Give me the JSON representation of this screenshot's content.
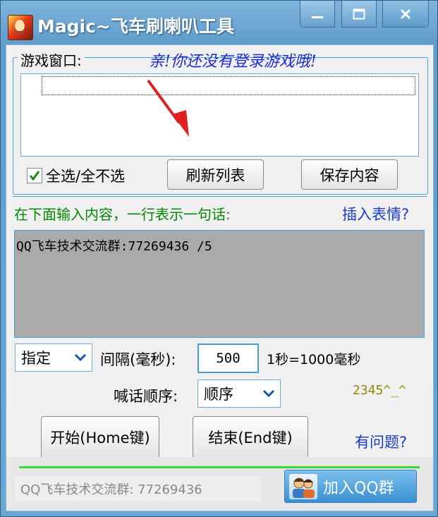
{
  "window": {
    "title": "Magic~飞车刷喇叭工具",
    "controls": {
      "minimize": "minimize-icon",
      "maximize": "maximize-icon",
      "close": "close-icon"
    }
  },
  "game_window_group": {
    "label": "游戏窗口:",
    "hint": "亲!你还没有登录游戏哦!",
    "select_all_checkbox": {
      "label": "全选/全不选",
      "checked": true
    },
    "refresh_button": "刷新列表",
    "save_button": "保存内容"
  },
  "message_input": {
    "instruction": "在下面输入内容，一行表示一句话:",
    "insert_emoji_link": "插入表情?",
    "content": "QQ飞车技术交流群:77269436 /5"
  },
  "settings": {
    "mode_select": "指定",
    "interval_label": "间隔(毫秒):",
    "interval_value": "500",
    "interval_note": "1秒=1000毫秒",
    "order_label": "喊话顺序:",
    "order_select": "顺序",
    "face_text": "2345^_^"
  },
  "actions": {
    "start_button": "开始(Home键)",
    "end_button": "结束(End键)",
    "help_link": "有问题?"
  },
  "footer": {
    "group_text": "QQ飞车技术交流群: 77269436",
    "join_qq_button": "加入QQ群"
  },
  "colors": {
    "titlebar": "#5f9ccb",
    "group_border": "#4aa3d2",
    "hint_text": "#1e2ad2",
    "instruction_text": "#078707",
    "link_text": "#1a3cc8",
    "textarea_bg": "#aaaaaa",
    "progress_line": "#35d835"
  }
}
